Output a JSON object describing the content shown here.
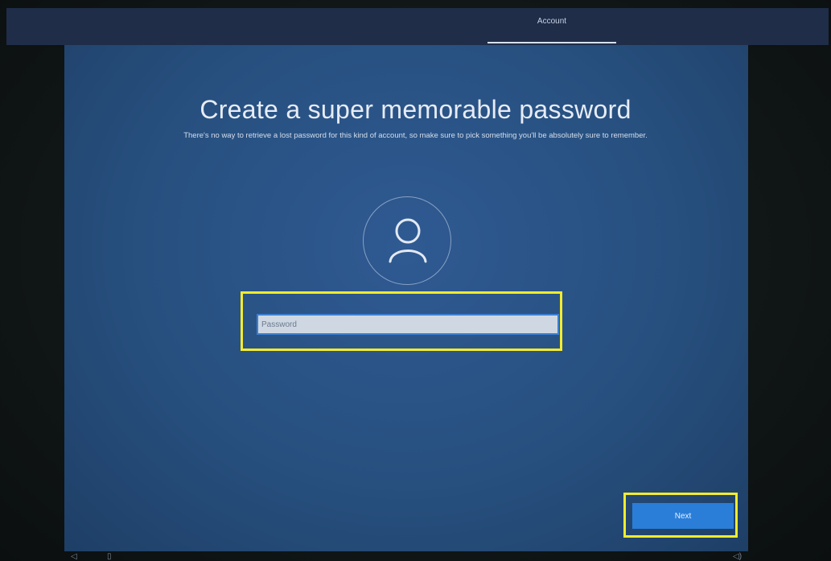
{
  "header": {
    "tab_label": "Account"
  },
  "main": {
    "title": "Create a super memorable password",
    "subtitle": "There's no way to retrieve a lost password for this kind of account, so make sure to pick something you'll be absolutely sure to remember.",
    "avatar_icon": "user-icon",
    "password_field": {
      "placeholder": "Password",
      "value": ""
    },
    "next_label": "Next"
  },
  "taskbar": {
    "icons": [
      "ease-of-access-icon",
      "microphone-icon",
      "volume-icon"
    ]
  },
  "colors": {
    "background": "#27507f",
    "accent": "#2a7ed8",
    "highlight": "#f4ec2c"
  }
}
